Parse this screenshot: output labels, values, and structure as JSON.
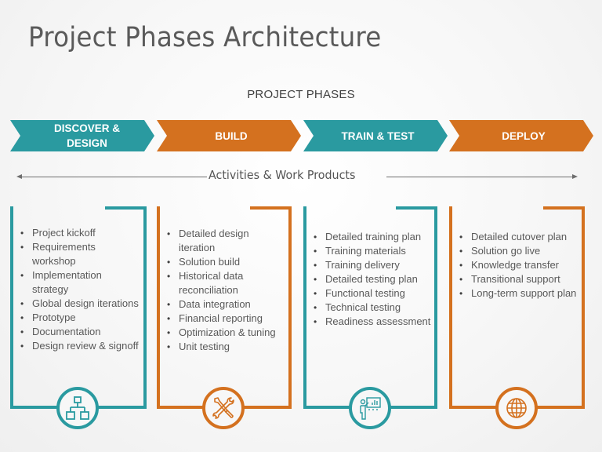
{
  "title": "Project Phases Architecture",
  "subtitle": "PROJECT PHASES",
  "colors": {
    "teal": "#2a9aa0",
    "orange": "#d4711f",
    "text": "#595959"
  },
  "phases": [
    {
      "label_line1": "DISCOVER &",
      "label_line2": "DESIGN",
      "color": "teal",
      "icon": "hierarchy-chart-icon"
    },
    {
      "label_line1": "BUILD",
      "label_line2": "",
      "color": "orange",
      "icon": "tools-icon"
    },
    {
      "label_line1": "TRAIN & TEST",
      "label_line2": "",
      "color": "teal",
      "icon": "presentation-icon"
    },
    {
      "label_line1": "DEPLOY",
      "label_line2": "",
      "color": "orange",
      "icon": "globe-icon"
    }
  ],
  "activities_label": "Activities & Work Products",
  "panels": [
    {
      "items": [
        "Project kickoff",
        "Requirements workshop",
        "Implementation strategy",
        "Global design iterations",
        "Prototype",
        "Documentation",
        "Design review & signoff"
      ]
    },
    {
      "items": [
        "Detailed design iteration",
        "Solution build",
        "Historical data reconciliation",
        "Data integration",
        "Financial reporting",
        "Optimization & tuning",
        "Unit testing"
      ]
    },
    {
      "items": [
        "Detailed training plan",
        "Training materials",
        "Training delivery",
        "Detailed testing plan",
        "Functional testing",
        "Technical testing",
        "Readiness assessment"
      ]
    },
    {
      "items": [
        "Detailed cutover plan",
        "Solution go live",
        "Knowledge transfer",
        "Transitional support",
        "Long-term support plan"
      ]
    }
  ]
}
